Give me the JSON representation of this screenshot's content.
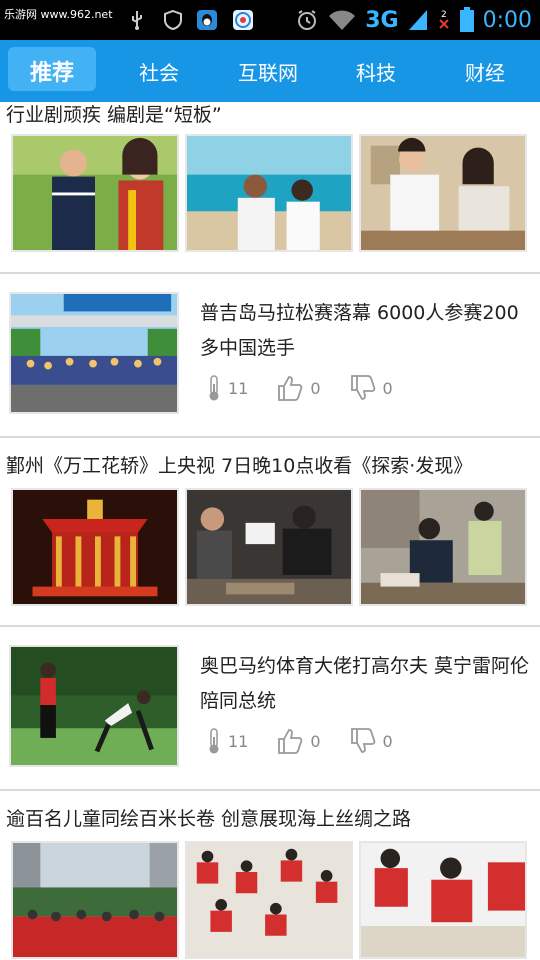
{
  "status_bar": {
    "watermark": "乐游网 www.962.net",
    "network": "3G",
    "time": "0:00"
  },
  "tabs": [
    {
      "label": "推荐",
      "active": true
    },
    {
      "label": "社会",
      "active": false
    },
    {
      "label": "互联网",
      "active": false
    },
    {
      "label": "科技",
      "active": false
    },
    {
      "label": "财经",
      "active": false
    }
  ],
  "feed": {
    "item1": {
      "title": "行业剧顽疾 编剧是“短板”"
    },
    "item2": {
      "title": "普吉岛马拉松赛落幕 6000人参赛200多中国选手",
      "views": "11",
      "likes": "0",
      "dislikes": "0"
    },
    "item3": {
      "title": "鄞州《万工花轿》上央视 7日晚10点收看《探索·发现》"
    },
    "item4": {
      "title": "奥巴马约体育大佬打高尔夫 莫宁雷阿伦陪同总统",
      "views": "11",
      "likes": "0",
      "dislikes": "0"
    },
    "item5": {
      "title": "逾百名儿童同绘百米长卷 创意展现海上丝绸之路"
    }
  },
  "colors": {
    "tab_bar": "#1896e6",
    "tab_active": "#43b2f5",
    "status_bar": "#000000",
    "clock": "#39b6ff"
  }
}
